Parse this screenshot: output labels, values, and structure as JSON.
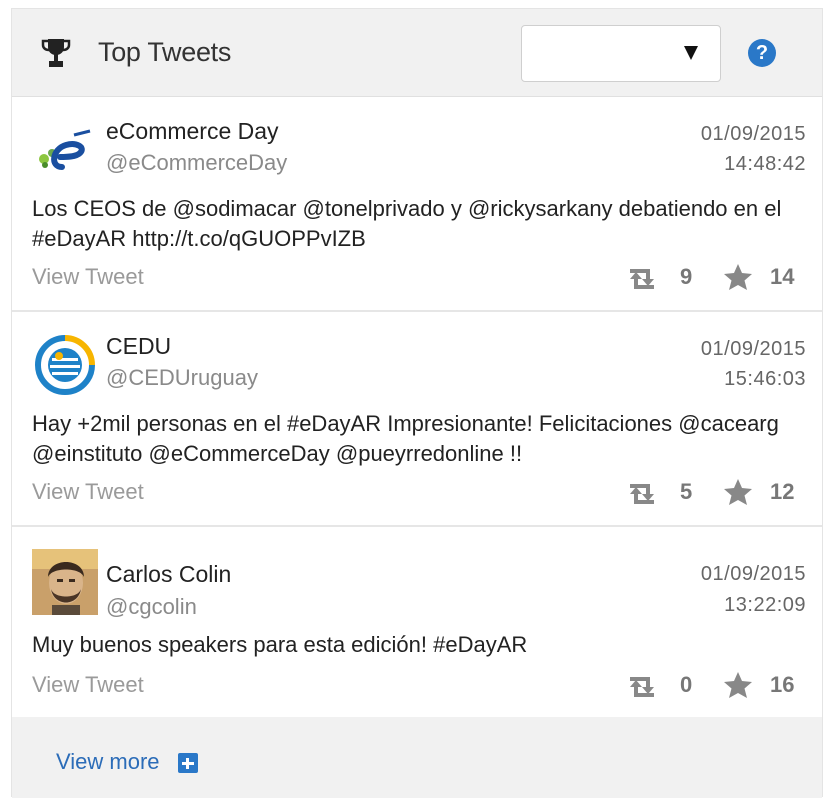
{
  "header": {
    "title": "Top Tweets",
    "icon": "trophy-icon",
    "select_value": "",
    "help_label": "?"
  },
  "tweets": [
    {
      "name": "eCommerce Day",
      "handle": "@eCommerceDay",
      "date": "01/09/2015",
      "time": "14:48:42",
      "text": "Los CEOS de @sodimacar @tonelprivado y @rickysarkany debatiendo en el #eDayAR http://t.co/qGUOPPvIZB",
      "view_label": "View Tweet",
      "retweets": "9",
      "favorites": "14"
    },
    {
      "name": "CEDU",
      "handle": "@CEDUruguay",
      "date": "01/09/2015",
      "time": "15:46:03",
      "text": "Hay +2mil personas en el #eDayAR Impresionante! Felicitaciones @cacearg @einstituto @eCommerceDay @pueyrredonline !!",
      "view_label": "View Tweet",
      "retweets": "5",
      "favorites": "12"
    },
    {
      "name": "Carlos Colin",
      "handle": "@cgcolin",
      "date": "01/09/2015",
      "time": "13:22:09",
      "text": "Muy buenos speakers para esta edición! #eDayAR",
      "view_label": "View Tweet",
      "retweets": "0",
      "favorites": "16"
    }
  ],
  "footer": {
    "view_more": "View more"
  },
  "colors": {
    "link": "#2b6cb8",
    "accent": "#2a78c8",
    "header_bg": "#f1f1f1"
  }
}
